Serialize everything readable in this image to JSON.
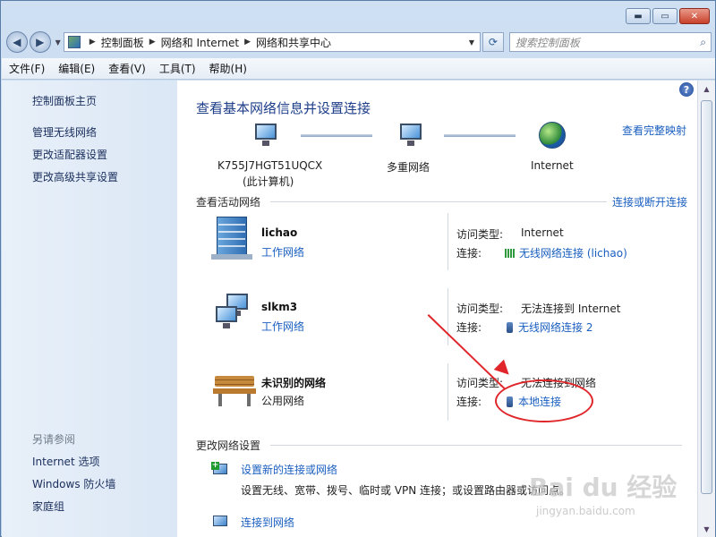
{
  "window": {
    "minimize_glyph": "▬",
    "maximize_glyph": "▭",
    "close_glyph": "✕"
  },
  "address": {
    "crumbs": [
      "控制面板",
      "网络和 Internet",
      "网络和共享中心"
    ],
    "search_placeholder": "搜索控制面板"
  },
  "menu": [
    "文件(F)",
    "编辑(E)",
    "查看(V)",
    "工具(T)",
    "帮助(H)"
  ],
  "sidebar": {
    "links": [
      "控制面板主页",
      "管理无线网络",
      "更改适配器设置",
      "更改高级共享设置"
    ],
    "see_also_title": "另请参阅",
    "see_also": [
      "Internet 选项",
      "Windows 防火墙",
      "家庭组"
    ]
  },
  "main": {
    "title": "查看基本网络信息并设置连接",
    "view_full_map": "查看完整映射",
    "map": {
      "computer_name": "K755J7HGT51UQCX",
      "computer_sub": "(此计算机)",
      "multi_network": "多重网络",
      "internet": "Internet"
    },
    "active_title": "查看活动网络",
    "connect_or_disconnect": "连接或断开连接",
    "networks": [
      {
        "name": "lichao",
        "type": "工作网络",
        "access_label": "访问类型:",
        "access": "Internet",
        "conn_label": "连接:",
        "conn": "无线网络连接 (lichao)"
      },
      {
        "name": "slkm3",
        "type": "工作网络",
        "access_label": "访问类型:",
        "access": "无法连接到 Internet",
        "conn_label": "连接:",
        "conn": "无线网络连接 2"
      },
      {
        "name": "未识别的网络",
        "type": "公用网络",
        "access_label": "访问类型:",
        "access": "无法连接到网络",
        "conn_label": "连接:",
        "conn": "本地连接"
      }
    ],
    "change_title": "更改网络设置",
    "settings": [
      {
        "link": "设置新的连接或网络",
        "desc": "设置无线、宽带、拨号、临时或 VPN 连接；或设置路由器或访问点。"
      },
      {
        "link": "连接到网络"
      }
    ]
  },
  "watermark": {
    "main": "Bai du 经验",
    "sub": "jingyan.baidu.com"
  },
  "colors": {
    "link": "#1a5fc0",
    "title": "#1e3e8a",
    "annotation": "#e1262b"
  }
}
